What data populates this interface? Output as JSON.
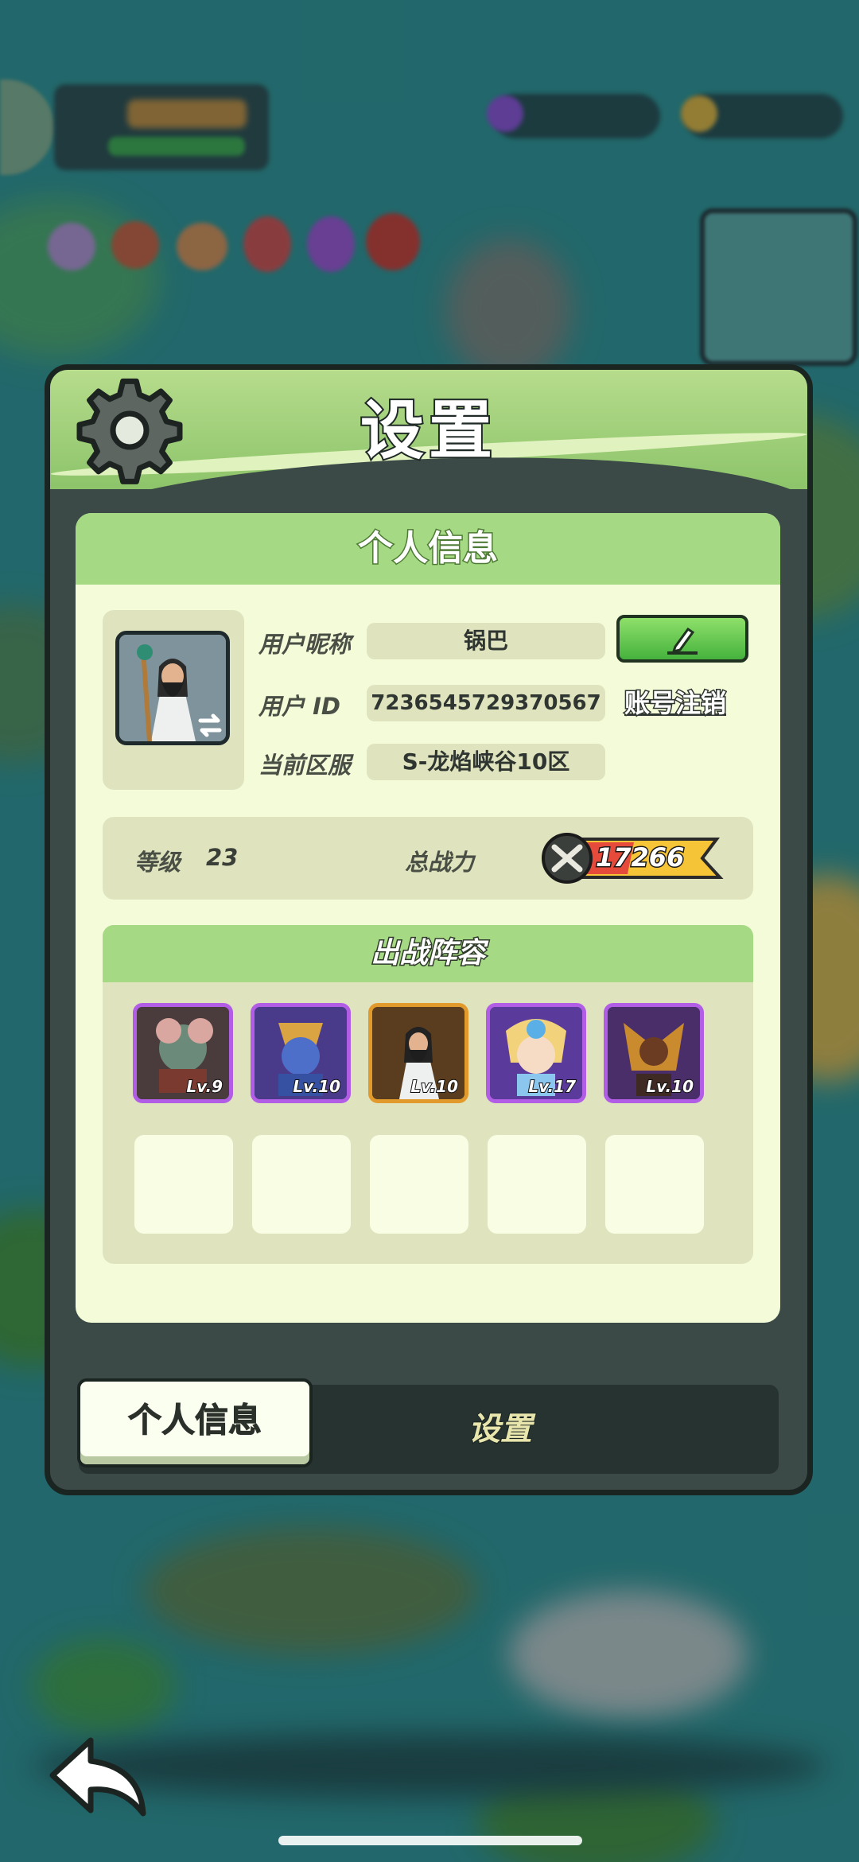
{
  "dialog": {
    "title": "设置"
  },
  "personal_info": {
    "header": "个人信息",
    "nickname_label": "用户昵称",
    "nickname": "锅巴",
    "user_id_label": "用户 ID",
    "user_id": "7236545729370567",
    "server_label": "当前区服",
    "server": "S-龙焰峡谷10区",
    "account_cancel": "账号注销",
    "level_label": "等级",
    "level": "23",
    "power_label": "总战力",
    "power": "17266"
  },
  "team": {
    "header": "出战阵容",
    "heroes": [
      {
        "level": "Lv.9",
        "frame": "purple"
      },
      {
        "level": "Lv.10",
        "frame": "purple"
      },
      {
        "level": "Lv.10",
        "frame": "orange"
      },
      {
        "level": "Lv.17",
        "frame": "purple"
      },
      {
        "level": "Lv.10",
        "frame": "purple"
      }
    ],
    "empty_slots": 5
  },
  "tabs": {
    "personal": "个人信息",
    "settings": "设置"
  },
  "colors": {
    "panel_green": "#a6d983",
    "card_bg": "#f3fbd9",
    "frame_purple": "#b25de6",
    "frame_orange": "#e39a2d",
    "edit_green": "#45b23d"
  }
}
